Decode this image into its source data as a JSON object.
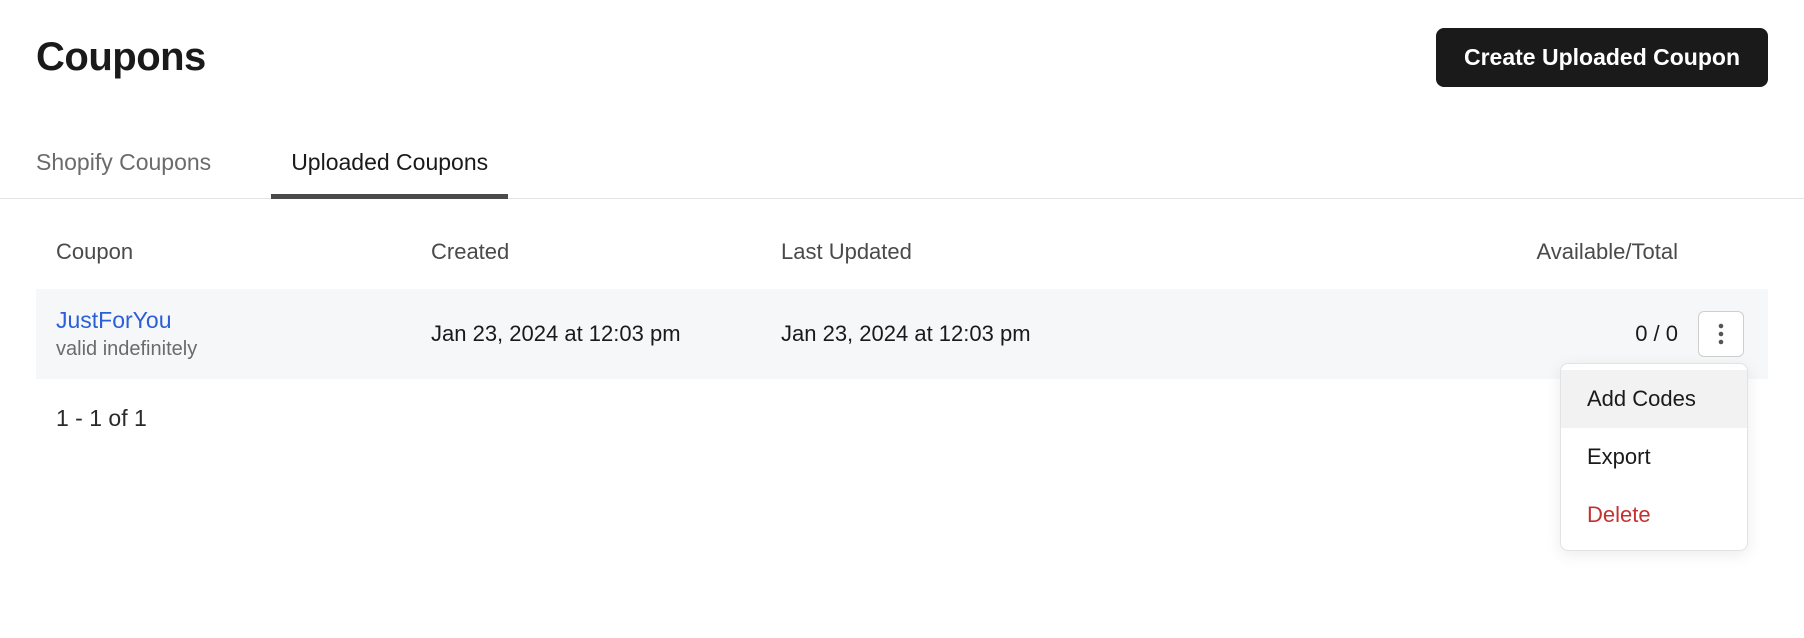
{
  "header": {
    "title": "Coupons",
    "create_button": "Create Uploaded Coupon"
  },
  "tabs": {
    "shopify": "Shopify Coupons",
    "uploaded": "Uploaded Coupons"
  },
  "table": {
    "headers": {
      "coupon": "Coupon",
      "created": "Created",
      "updated": "Last Updated",
      "available": "Available/Total"
    },
    "rows": [
      {
        "name": "JustForYou",
        "validity": "valid indefinitely",
        "created": "Jan 23, 2024 at 12:03 pm",
        "updated": "Jan 23, 2024 at 12:03 pm",
        "available_total": "0 / 0"
      }
    ]
  },
  "dropdown": {
    "add_codes": "Add Codes",
    "export": "Export",
    "delete": "Delete"
  },
  "pager": "1 - 1 of 1"
}
